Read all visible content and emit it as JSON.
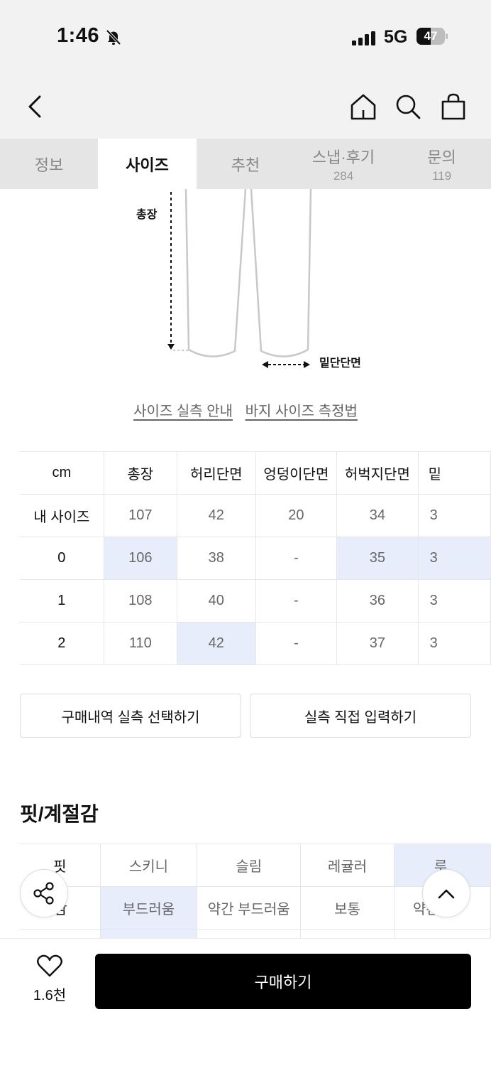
{
  "status": {
    "time": "1:46",
    "network": "5G",
    "battery": "47"
  },
  "tabs": [
    {
      "label": "정보",
      "count": ""
    },
    {
      "label": "사이즈",
      "count": ""
    },
    {
      "label": "추천",
      "count": ""
    },
    {
      "label": "스냅·후기",
      "count": "284"
    },
    {
      "label": "문의",
      "count": "119"
    }
  ],
  "diagram": {
    "total_length_label": "총장",
    "hem_label": "밑단단면"
  },
  "links": {
    "size_guide": "사이즈 실측 안내",
    "pants_measure": "바지 사이즈 측정법"
  },
  "size_table": {
    "headers": [
      "cm",
      "총장",
      "허리단면",
      "엉덩이단면",
      "허벅지단면",
      "밑"
    ],
    "rows": [
      {
        "label": "내 사이즈",
        "cells": [
          "107",
          "42",
          "20",
          "34",
          "3"
        ]
      },
      {
        "label": "0",
        "cells": [
          "106",
          "38",
          "-",
          "35",
          "3"
        ]
      },
      {
        "label": "1",
        "cells": [
          "108",
          "40",
          "-",
          "36",
          "3"
        ]
      },
      {
        "label": "2",
        "cells": [
          "110",
          "42",
          "-",
          "37",
          "3"
        ]
      }
    ]
  },
  "buttons": {
    "purchase_history": "구매내역 실측 선택하기",
    "direct_input": "실측 직접 입력하기"
  },
  "fit_section": {
    "title": "핏/계절감",
    "rows": [
      {
        "label": "핏",
        "cells": [
          "스키니",
          "슬림",
          "레귤러",
          "루"
        ]
      },
      {
        "label": "감",
        "cells": [
          "부드러움",
          "약간 부드러움",
          "보통",
          "약간"
        ]
      }
    ]
  },
  "bottom": {
    "like_count": "1.6천",
    "buy_label": "구매하기"
  }
}
